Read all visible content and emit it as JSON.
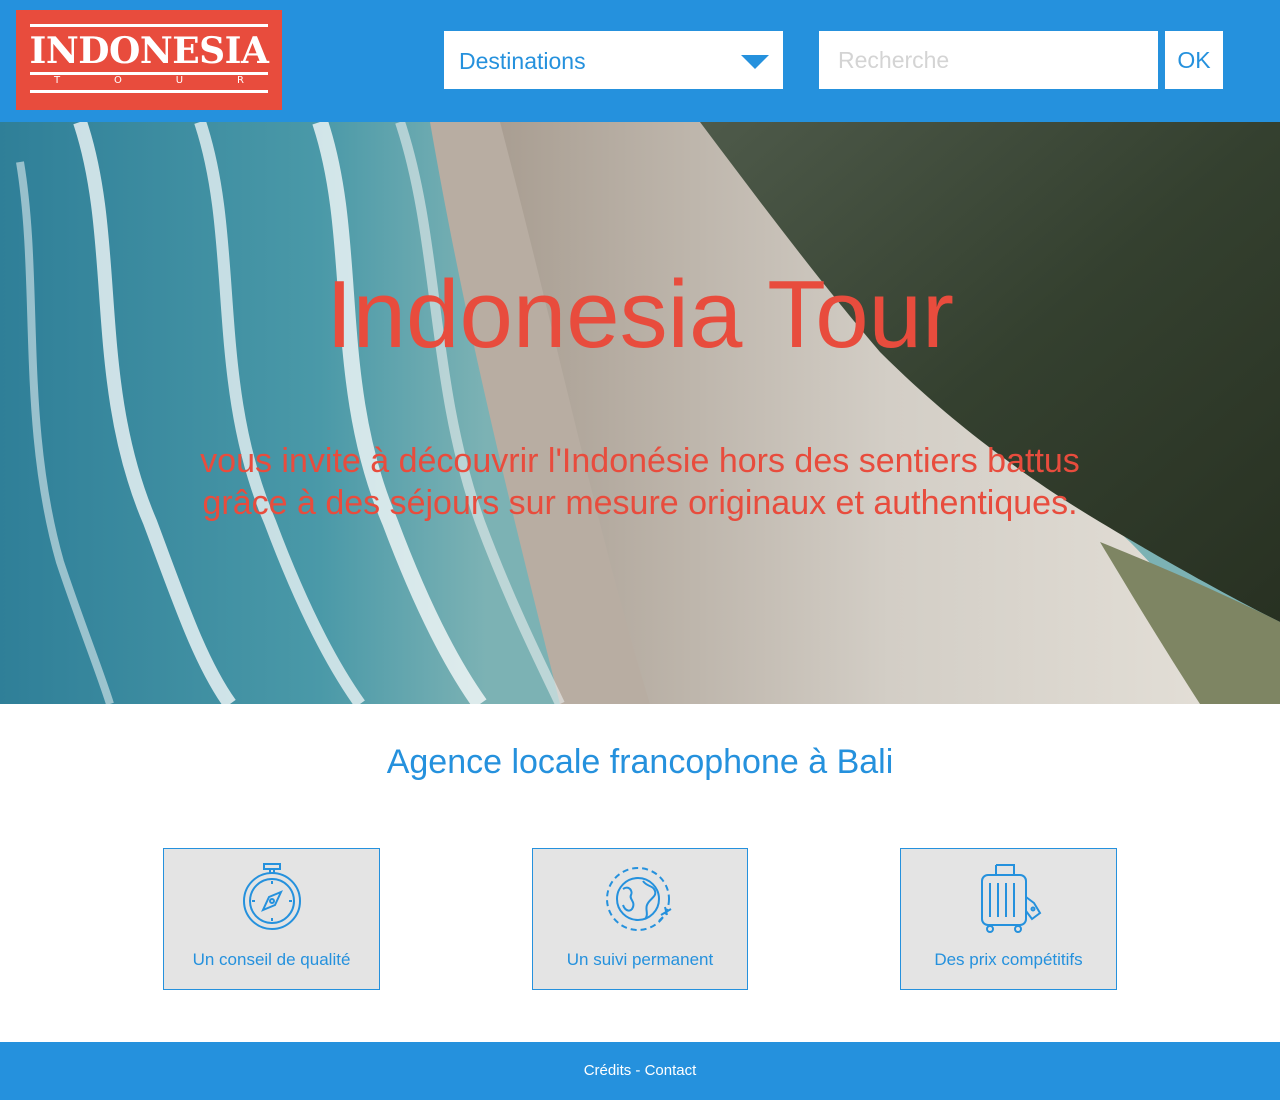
{
  "header": {
    "logo": {
      "word": "INDONESIA",
      "letters": [
        "T",
        "O",
        "U",
        "R"
      ]
    },
    "destinations_label": "Destinations",
    "search_placeholder": "Recherche",
    "ok_label": "OK"
  },
  "hero": {
    "title": "Indonesia Tour",
    "line1": "vous invite à découvrir l'Indonésie hors des sentiers battus",
    "line2": "grâce à des séjours sur mesure originaux et authentiques."
  },
  "main": {
    "title": "Agence locale francophone à Bali",
    "features": [
      {
        "icon": "compass-icon",
        "label": "Un conseil de qualité"
      },
      {
        "icon": "globe-plane-icon",
        "label": "Un suivi permanent"
      },
      {
        "icon": "luggage-icon",
        "label": "Des prix compétitifs"
      }
    ]
  },
  "footer": {
    "credits": "Crédits",
    "separator": " - ",
    "contact": "Contact"
  },
  "colors": {
    "brand_blue": "#2591dd",
    "brand_red": "#e84c3d",
    "card_bg": "#e4e4e4"
  }
}
